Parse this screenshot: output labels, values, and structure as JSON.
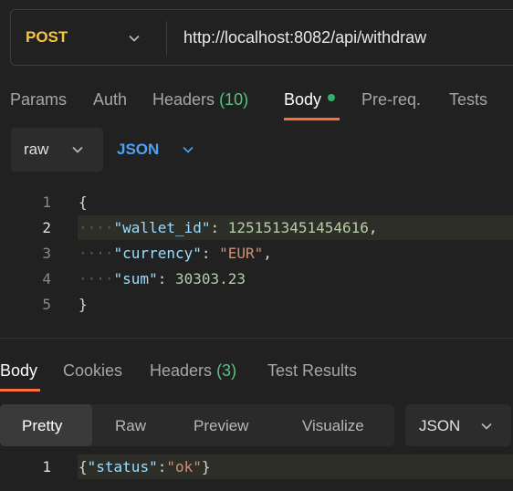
{
  "request": {
    "method": "POST",
    "url": "http://localhost:8082/api/withdraw"
  },
  "request_tabs": {
    "params": "Params",
    "auth": "Auth",
    "headers": "Headers",
    "headers_count": "(10)",
    "body": "Body",
    "prereq": "Pre-req.",
    "tests": "Tests"
  },
  "body_mode": {
    "mode": "raw",
    "format": "JSON"
  },
  "editor": {
    "line_numbers": [
      "1",
      "2",
      "3",
      "4",
      "5"
    ],
    "open_brace": "{",
    "close_brace": "}",
    "wallet_key": "\"wallet_id\"",
    "wallet_value": "1251513451454616",
    "currency_key": "\"currency\"",
    "currency_value": "\"EUR\"",
    "sum_key": "\"sum\"",
    "sum_value": "30303.23",
    "colon": ": ",
    "comma": ","
  },
  "response_tabs": {
    "body": "Body",
    "cookies": "Cookies",
    "headers": "Headers",
    "headers_count": "(3)",
    "test_results": "Test Results"
  },
  "response_view": {
    "pretty": "Pretty",
    "raw": "Raw",
    "preview": "Preview",
    "visualize": "Visualize",
    "format": "JSON"
  },
  "response_body": {
    "line_number": "1",
    "open": "{",
    "key": "\"status\"",
    "colon": ":",
    "value": "\"ok\"",
    "close": "}"
  },
  "colors": {
    "method": "#f6c344",
    "accent": "#ff6c37",
    "json_blue": "#4ea2f5",
    "count_green": "#57c47d"
  }
}
